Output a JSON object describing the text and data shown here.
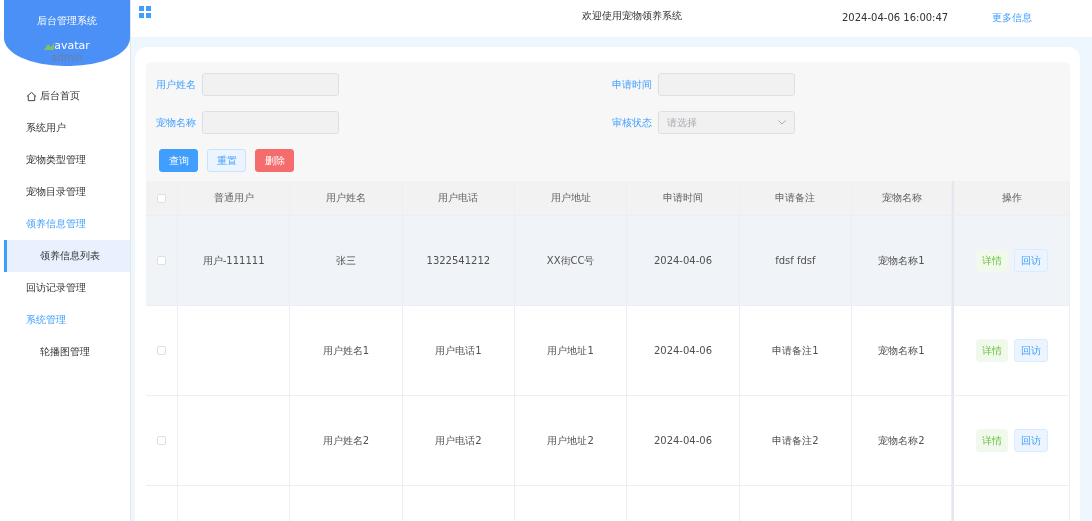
{
  "sidebar": {
    "title": "后台管理系统",
    "avatar_alt": "avatar",
    "username": "admin",
    "menu": [
      {
        "label": "后台首页",
        "kind": "home",
        "selected": false
      },
      {
        "label": "系统用户",
        "kind": "item",
        "selected": false
      },
      {
        "label": "宠物类型管理",
        "kind": "item",
        "selected": false
      },
      {
        "label": "宠物目录管理",
        "kind": "item",
        "selected": false
      },
      {
        "label": "领养信息管理",
        "kind": "group",
        "selected": false,
        "expanded": true,
        "children": [
          {
            "label": "领养信息列表",
            "selected": true
          }
        ]
      },
      {
        "label": "回访记录管理",
        "kind": "item",
        "selected": false
      },
      {
        "label": "系统管理",
        "kind": "group",
        "selected": false,
        "expanded": true,
        "children": [
          {
            "label": "轮播图管理",
            "selected": false
          }
        ]
      }
    ]
  },
  "topbar": {
    "title": "欢迎使用宠物领养系统",
    "datetime": "2024-04-06 16:00:47",
    "link": "更多信息"
  },
  "filters": [
    {
      "label": "用户姓名",
      "kind": "input"
    },
    {
      "label": "申请时间",
      "kind": "input"
    },
    {
      "label": "宠物名称",
      "kind": "input"
    },
    {
      "label": "审核状态",
      "kind": "select",
      "placeholder": "请选择"
    }
  ],
  "actions": [
    {
      "label": "查询",
      "kind": "primary"
    },
    {
      "label": "重置",
      "kind": "plain"
    },
    {
      "label": "删除",
      "kind": "danger"
    }
  ],
  "table": {
    "all_checked": false,
    "columns": [
      "普通用户",
      "用户姓名",
      "用户电话",
      "用户地址",
      "申请时间",
      "申请备注",
      "宠物名称",
      "操作"
    ],
    "rows": [
      {
        "checked": false,
        "highlighted": true,
        "cells": [
          "用户-111111",
          "张三",
          "1322541212",
          "XX街CC号",
          "2024-04-06",
          "fdsf fdsf",
          "宠物名称1"
        ],
        "buttons": [
          {
            "label": "详情",
            "kind": "success"
          },
          {
            "label": "回访",
            "kind": "info"
          }
        ]
      },
      {
        "checked": false,
        "highlighted": false,
        "cells": [
          null,
          "用户姓名1",
          "用户电话1",
          "用户地址1",
          "2024-04-06",
          "申请备注1",
          "宠物名称1"
        ],
        "buttons": [
          {
            "label": "详情",
            "kind": "success"
          },
          {
            "label": "回访",
            "kind": "info"
          }
        ]
      },
      {
        "checked": false,
        "highlighted": false,
        "cells": [
          null,
          "用户姓名2",
          "用户电话2",
          "用户地址2",
          "2024-04-06",
          "申请备注2",
          "宠物名称2"
        ],
        "buttons": [
          {
            "label": "详情",
            "kind": "success"
          },
          {
            "label": "回访",
            "kind": "info"
          }
        ]
      }
    ]
  }
}
